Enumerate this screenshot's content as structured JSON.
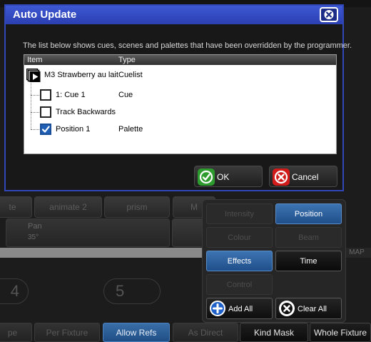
{
  "background": {
    "top_buttons": [
      "te",
      "animate 2",
      "prism",
      "M"
    ],
    "pan": {
      "label": "Pan",
      "value": "35°"
    },
    "map_label": "MAP",
    "wheels": [
      "4",
      "5"
    ],
    "bottom_bar": [
      "pe",
      "Per Fixture",
      "Allow Refs",
      "As Direct",
      "Kind Mask",
      "Whole Fixture"
    ]
  },
  "dialog": {
    "title": "Auto Update",
    "description": "The list below shows cues, scenes and palettes that have been overridden by the programmer.",
    "columns": {
      "item": "Item",
      "type": "Type"
    },
    "rows": [
      {
        "item": "M3 Strawberry au lait",
        "type": "Cuelist"
      },
      {
        "item": "1: Cue 1",
        "type": "Cue",
        "checked": false
      },
      {
        "item": "Track Backwards",
        "type": "",
        "checked": false
      },
      {
        "item": "Position 1",
        "type": "Palette",
        "checked": true
      }
    ],
    "ok_label": "OK",
    "cancel_label": "Cancel"
  },
  "kind_mask": {
    "buttons": [
      "Intensity",
      "Position",
      "Colour",
      "Beam",
      "Effects",
      "Time",
      "Control"
    ],
    "add_all_label": "Add All",
    "clear_all_label": "Clear All"
  },
  "colors": {
    "title_bar": "#2f47b8",
    "selected_blue": "#2a5f9f",
    "ok_green": "#2d9b2d",
    "cancel_red": "#d11b1b",
    "add_blue": "#1f61c9"
  }
}
